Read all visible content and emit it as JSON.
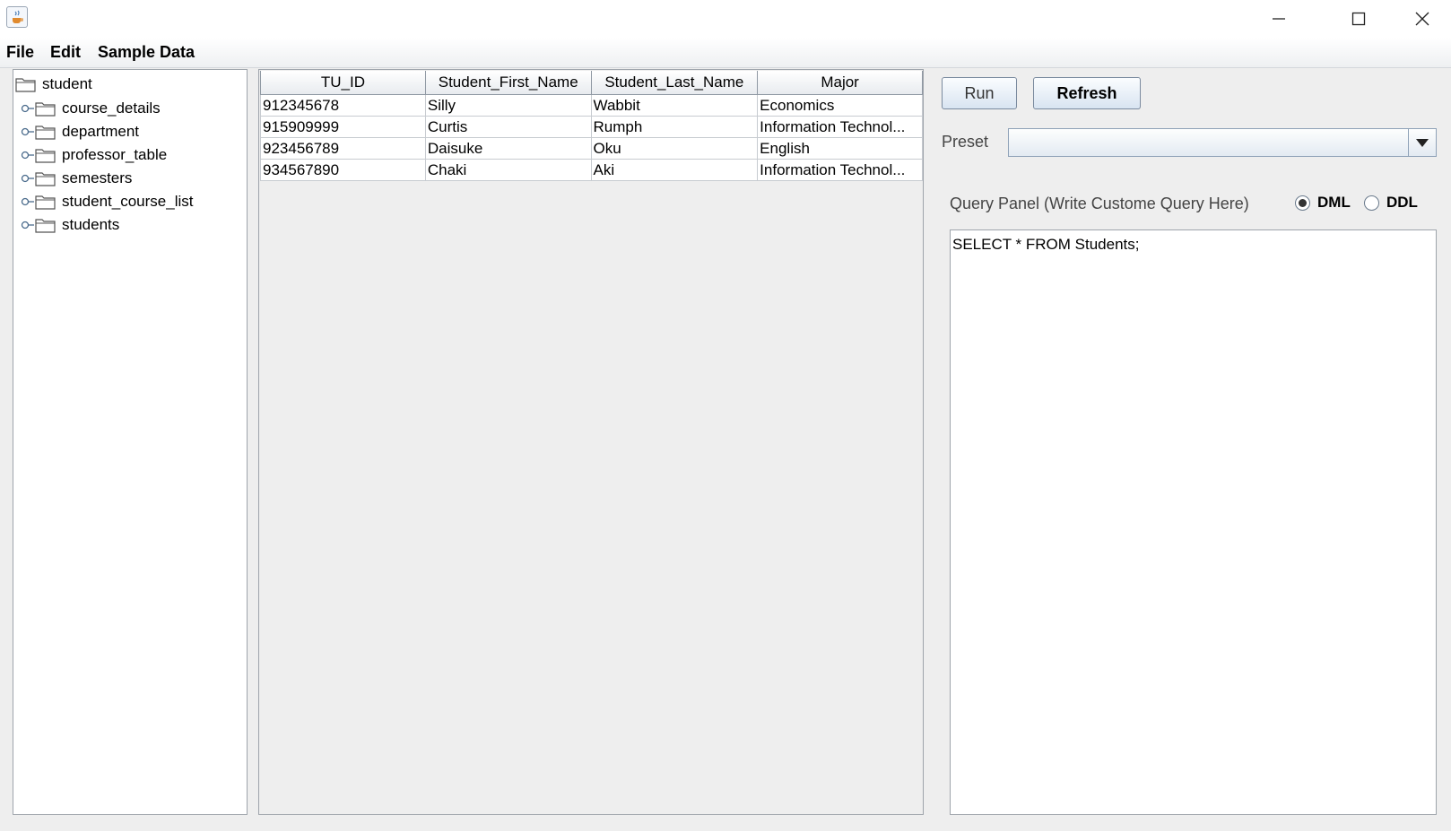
{
  "window": {
    "minimize_icon": "minimize-icon",
    "maximize_icon": "maximize-icon",
    "close_icon": "close-icon"
  },
  "menu": {
    "file": "File",
    "edit": "Edit",
    "sample_data": "Sample Data"
  },
  "tree": {
    "root": "student",
    "items": [
      {
        "label": "course_details"
      },
      {
        "label": "department"
      },
      {
        "label": "professor_table"
      },
      {
        "label": "semesters"
      },
      {
        "label": "student_course_list"
      },
      {
        "label": "students"
      }
    ]
  },
  "table": {
    "columns": [
      "TU_ID",
      "Student_First_Name",
      "Student_Last_Name",
      "Major"
    ],
    "rows": [
      [
        "912345678",
        "Silly",
        "Wabbit",
        "Economics"
      ],
      [
        "915909999",
        "Curtis",
        "Rumph",
        "Information Technol..."
      ],
      [
        "923456789",
        "Daisuke",
        "Oku",
        "English"
      ],
      [
        "934567890",
        "Chaki",
        "Aki",
        "Information Technol..."
      ]
    ]
  },
  "controls": {
    "run_label": "Run",
    "refresh_label": "Refresh",
    "preset_label": "Preset",
    "preset_value": "",
    "query_panel_label": "Query Panel (Write Custome Query Here)",
    "dml_label": "DML",
    "ddl_label": "DDL",
    "selected_mode": "DML",
    "query_text": "SELECT * FROM Students;"
  },
  "colors": {
    "accent": "#d8e4f1",
    "border": "#9ea4ab"
  }
}
